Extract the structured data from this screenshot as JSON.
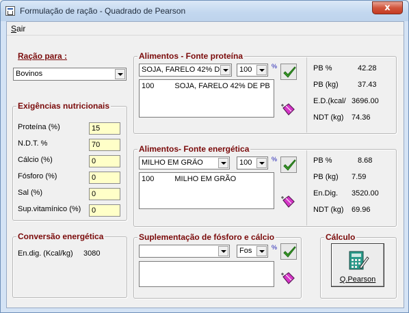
{
  "window": {
    "title": "Formulação de ração - Quadrado de Pearson",
    "close_glyph": "x"
  },
  "menu": {
    "sair_first": "S",
    "sair_rest": "air"
  },
  "racao": {
    "title": "Ração para :",
    "selected": "Bovinos"
  },
  "exigencias": {
    "title": "Exigências nutricionais",
    "items": [
      {
        "label": "Proteína (%)",
        "value": "15"
      },
      {
        "label": "N.D.T. %",
        "value": "70"
      },
      {
        "label": "Cálcio (%)",
        "value": "0"
      },
      {
        "label": "Fósforo (%)",
        "value": "0"
      },
      {
        "label": "Sal (%)",
        "value": "0"
      },
      {
        "label": "Sup.vitamínico (%)",
        "value": "0"
      }
    ]
  },
  "conversao": {
    "title": "Conversão energética",
    "label": "En.dig. (Kcal/kg)",
    "value": "3080"
  },
  "proteica": {
    "title": "Alimentos - Fonte proteína",
    "food_select": "SOJA, FARELO 42% D",
    "qty_select": "100",
    "pct": "%",
    "list": [
      {
        "qty": "100",
        "name": "SOJA, FARELO 42% DE PB"
      }
    ],
    "stats": [
      {
        "label": "PB %",
        "value": "42.28"
      },
      {
        "label": "PB (kg)",
        "value": "37.43"
      },
      {
        "label": "E.D.(kcal/",
        "value": "3696.00"
      },
      {
        "label": "NDT (kg)",
        "value": "74.36"
      }
    ]
  },
  "energetica": {
    "title": "Alimentos- Fonte energética",
    "food_select": "MILHO EM GRÃO",
    "qty_select": "100",
    "pct": "%",
    "list": [
      {
        "qty": "100",
        "name": "MILHO EM GRÃO"
      }
    ],
    "stats": [
      {
        "label": "PB %",
        "value": "8.68"
      },
      {
        "label": "PB (kg)",
        "value": "7.59"
      },
      {
        "label": "En.Dig.",
        "value": "3520.00"
      },
      {
        "label": "NDT (kg)",
        "value": "69.96"
      }
    ]
  },
  "suplementacao": {
    "title": "Suplementação de fósforo e cálcio",
    "food_select": "",
    "qty_select": "Fos",
    "pct": "%"
  },
  "calculo": {
    "title": "Cálculo",
    "button_label": "Q.Pearson"
  }
}
